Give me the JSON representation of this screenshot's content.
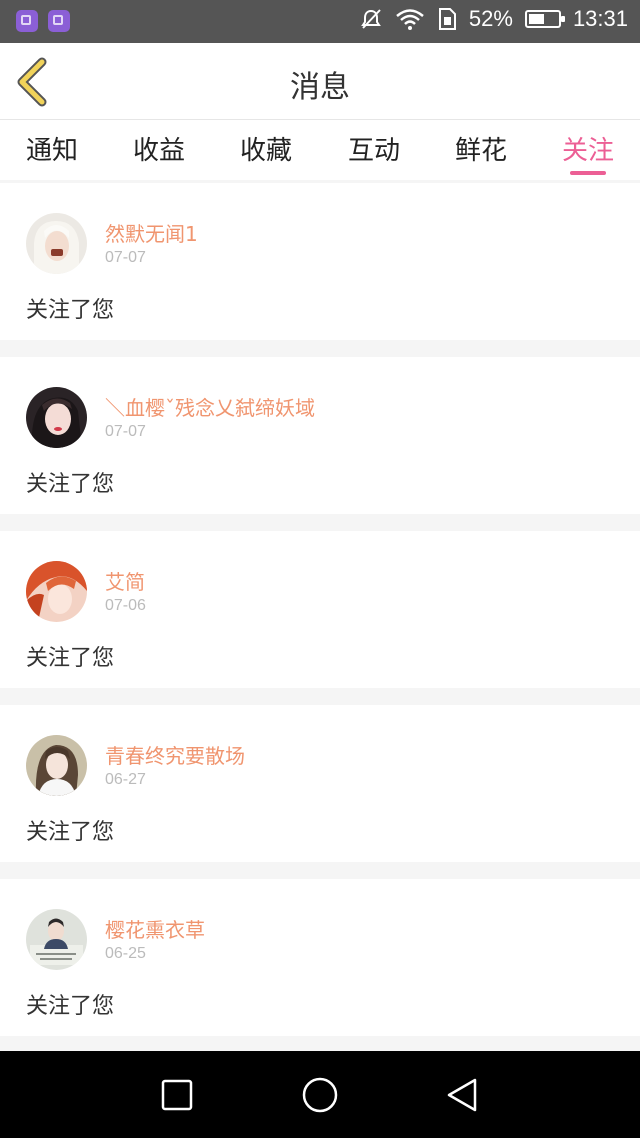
{
  "status_bar": {
    "battery_text": "52%",
    "battery_level": 0.52,
    "time": "13:31",
    "icons": [
      "gallery-app-icon",
      "gallery-app-icon",
      "mute-icon",
      "wifi-icon",
      "sim-icon",
      "battery-icon"
    ]
  },
  "header": {
    "title": "消息",
    "back_icon": "chevron-left-icon"
  },
  "tabs": [
    {
      "label": "通知",
      "active": false
    },
    {
      "label": "收益",
      "active": false
    },
    {
      "label": "收藏",
      "active": false
    },
    {
      "label": "互动",
      "active": false
    },
    {
      "label": "鲜花",
      "active": false
    },
    {
      "label": "关注",
      "active": true
    }
  ],
  "feed": [
    {
      "username": "然默无闻1",
      "date": "07-07",
      "message": "关注了您"
    },
    {
      "username": "＼血樱ˇ残念乂弑缔妖域",
      "date": "07-07",
      "message": "关注了您"
    },
    {
      "username": "艾简",
      "date": "07-06",
      "message": "关注了您"
    },
    {
      "username": "青春终究要散场",
      "date": "06-27",
      "message": "关注了您"
    },
    {
      "username": "樱花熏衣草",
      "date": "06-25",
      "message": "关注了您"
    }
  ],
  "nav_bar": {
    "icons": [
      "recents-square-icon",
      "home-circle-icon",
      "back-triangle-icon"
    ]
  },
  "colors": {
    "accent": "#ec5f95",
    "username": "#f0956f",
    "back_chevron": "#f1d35a"
  }
}
